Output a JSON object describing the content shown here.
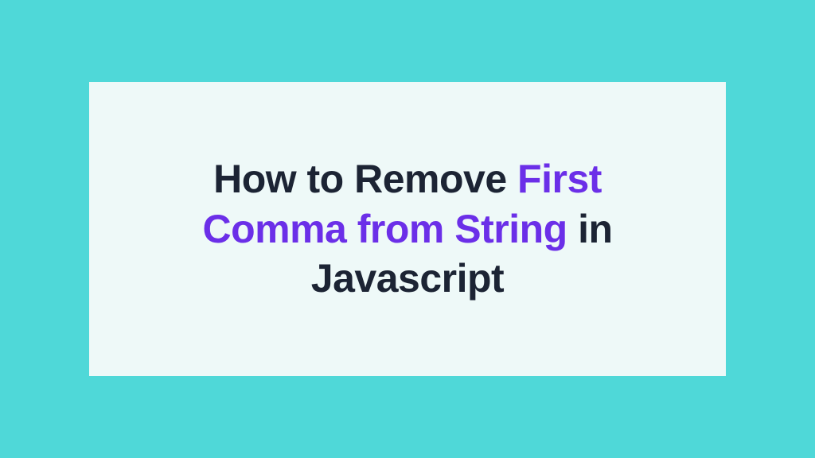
{
  "title": {
    "part1": "How to Remove ",
    "highlight": "First Comma from String",
    "part2": " in Javascript"
  },
  "colors": {
    "background": "#4fd8d8",
    "card": "#eef9f8",
    "textDark": "#1c2434",
    "textHighlight": "#6b2fe8"
  }
}
